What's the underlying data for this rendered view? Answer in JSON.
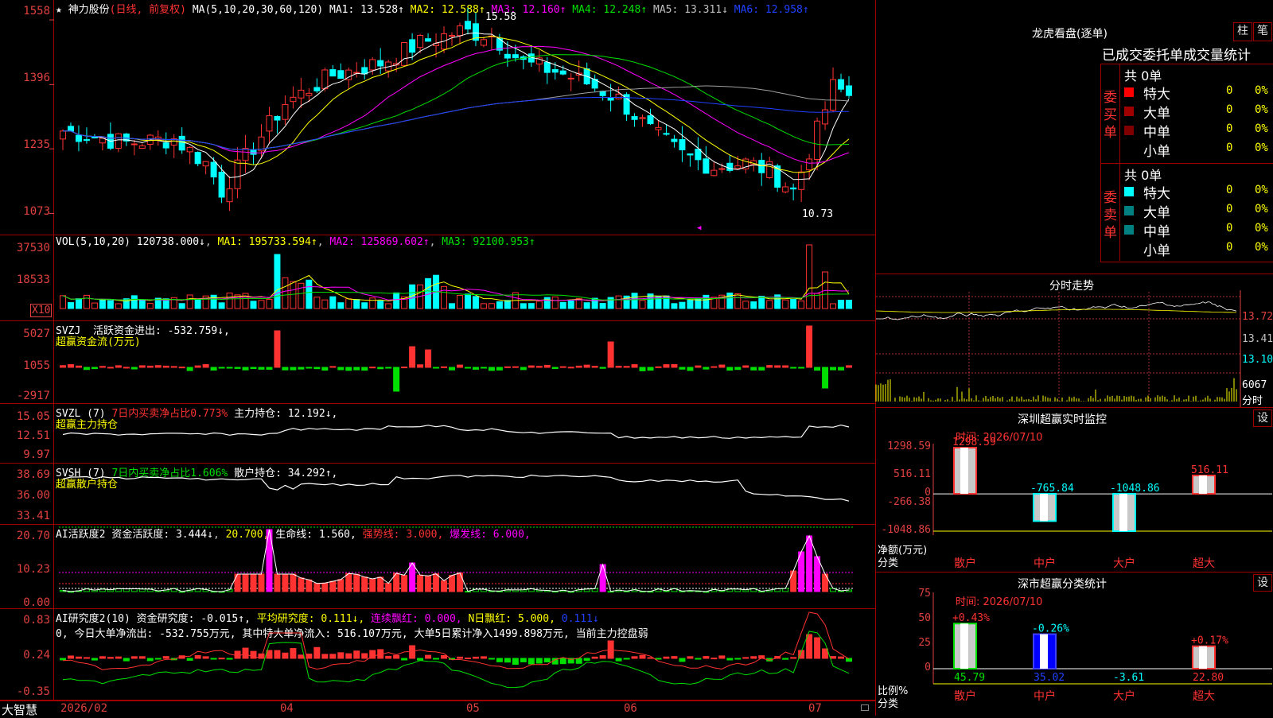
{
  "colors": {
    "up": "#ff3232",
    "down": "#00ffff",
    "axis": "#e04040",
    "grid": "#a00000",
    "white": "#ffffff",
    "yellow": "#ffff00",
    "magenta": "#ff00ff",
    "green": "#00e000",
    "gray": "#a0a0a0",
    "blue": "#2020ff"
  },
  "price": {
    "header": {
      "star": "★",
      "name": "神力股份",
      "mode": "(日线, 前复权)",
      "ma_label": "MA(5,10,20,30,60,120)",
      "ma1": "MA1: 13.528↑",
      "ma2": "MA2: 12.588↑",
      "ma3": "MA3: 12.160↑",
      "ma4": "MA4: 12.248↑",
      "ma5": "MA5: 13.311↓",
      "ma6": "MA6: 12.958↑"
    },
    "yticks": [
      "1558",
      "1396",
      "1235",
      "1073"
    ],
    "high_label": "15.58",
    "low_label": "10.73",
    "marker": "◀"
  },
  "vol": {
    "header": {
      "label": "VOL(5,10,20)",
      "val": "120738.000↓",
      "ma1": "MA1: 195733.594↑",
      "ma2": "MA2: 125869.602↑",
      "ma3": "MA3: 92100.953↑"
    },
    "yticks": [
      "37530",
      "18533"
    ],
    "unit": "X10"
  },
  "svzj": {
    "header": {
      "label": "SVZJ",
      "title": "活跃资金进出: -532.759↓,"
    },
    "sub": "超赢资金流(万元)",
    "yticks": [
      "5027",
      "1055",
      "-2917"
    ]
  },
  "svzl": {
    "header": {
      "label": "SVZL (7)",
      "pct": "7日内买卖净占比0.773%",
      "hold": "主力持仓: 12.192↓,"
    },
    "sub": "超赢主力持仓",
    "yticks": [
      "15.05",
      "12.51",
      "9.97"
    ]
  },
  "svsh": {
    "header": {
      "label": "SVSH (7)",
      "pct": "7日内买卖净占比1.606%",
      "hold": "散户持仓: 34.292↑,"
    },
    "sub": "超赢散户持仓",
    "yticks": [
      "38.69",
      "36.00",
      "33.41"
    ]
  },
  "ai1": {
    "header": {
      "label": "AI活跃度2",
      "act": "资金活跃度: 3.444↓",
      "v2": "20.700,",
      "life": "生命线: 1.560,",
      "strong": "强势线: 3.000,",
      "burst": "爆发线: 6.000,"
    },
    "yticks": [
      "20.70",
      "10.23",
      "0.00"
    ]
  },
  "ai2": {
    "header": {
      "label": "AI研究度2(10)",
      "res": "资金研究度: -0.015↑,",
      "avg": "平均研究度: 0.111↓,",
      "cont": "连续飘红: 0.000,",
      "nday": "N日飘红: 5.000,",
      "last": "0.111↓"
    },
    "sub": "0, 今日大单净流出: -532.755万元, 其中特大单净流入: 516.107万元, 大单5日累计净入1499.898万元, 当前主力控盘弱",
    "yticks": [
      "0.83",
      "0.24",
      "-0.35"
    ]
  },
  "xaxis": {
    "brand": "大智慧",
    "labels": [
      "2026/02",
      "04",
      "05",
      "06",
      "07"
    ]
  },
  "lhb": {
    "title": "龙虎看盘(逐单)",
    "btn1": "柱",
    "btn2": "笔",
    "tabs": "已成交委托单成交量统计",
    "buy_label": "委买单",
    "sell_label": "委卖单",
    "buy_total": "共 0单",
    "sell_total": "共 0单",
    "buy_rows": [
      {
        "name": "特大",
        "val": "0",
        "pct": "0%",
        "color": "#ff0000"
      },
      {
        "name": "大单",
        "val": "0",
        "pct": "0%",
        "color": "#a00000"
      },
      {
        "name": "中单",
        "val": "0",
        "pct": "0%",
        "color": "#800000"
      },
      {
        "name": "小单",
        "val": "0",
        "pct": "0%",
        "color": "#000000"
      }
    ],
    "sell_rows": [
      {
        "name": "特大",
        "val": "0",
        "pct": "0%",
        "color": "#00ffff"
      },
      {
        "name": "大单",
        "val": "0",
        "pct": "0%",
        "color": "#008080"
      },
      {
        "name": "中单",
        "val": "0",
        "pct": "0%",
        "color": "#008080"
      },
      {
        "name": "小单",
        "val": "0",
        "pct": "0%",
        "color": "#000000"
      }
    ]
  },
  "intraday": {
    "title": "分时走势",
    "yticks": [
      "13.72",
      "13.41",
      "13.10",
      "6067"
    ],
    "unit": "分时"
  },
  "monitor": {
    "title": "深圳超赢实时监控",
    "btn": "设",
    "time": "时间: 2026/07/10",
    "yticks": [
      "1298.59",
      "516.11",
      "0",
      "-266.38",
      "-1048.86"
    ],
    "ylabel": "净额(万元)",
    "xlabel": "分类",
    "bars": [
      {
        "cat": "散户",
        "val": "1298.59"
      },
      {
        "cat": "中户",
        "val": "-765.84"
      },
      {
        "cat": "大户",
        "val": "-1048.86"
      },
      {
        "cat": "超大",
        "val": "516.11"
      }
    ]
  },
  "classify": {
    "title": "深市超赢分类统计",
    "btn": "设",
    "time": "时间: 2026/07/10",
    "yticks": [
      "75",
      "50",
      "25",
      "0"
    ],
    "ylabel": "比例%",
    "xlabel": "分类",
    "bars": [
      {
        "cat": "散户",
        "top": "+0.43%",
        "bottom": "45.79"
      },
      {
        "cat": "中户",
        "top": "-0.26%",
        "bottom": "35.02"
      },
      {
        "cat": "大户",
        "top": "",
        "bottom": "-3.61"
      },
      {
        "cat": "超大",
        "top": "+0.17%",
        "bottom": "22.80"
      }
    ]
  }
}
